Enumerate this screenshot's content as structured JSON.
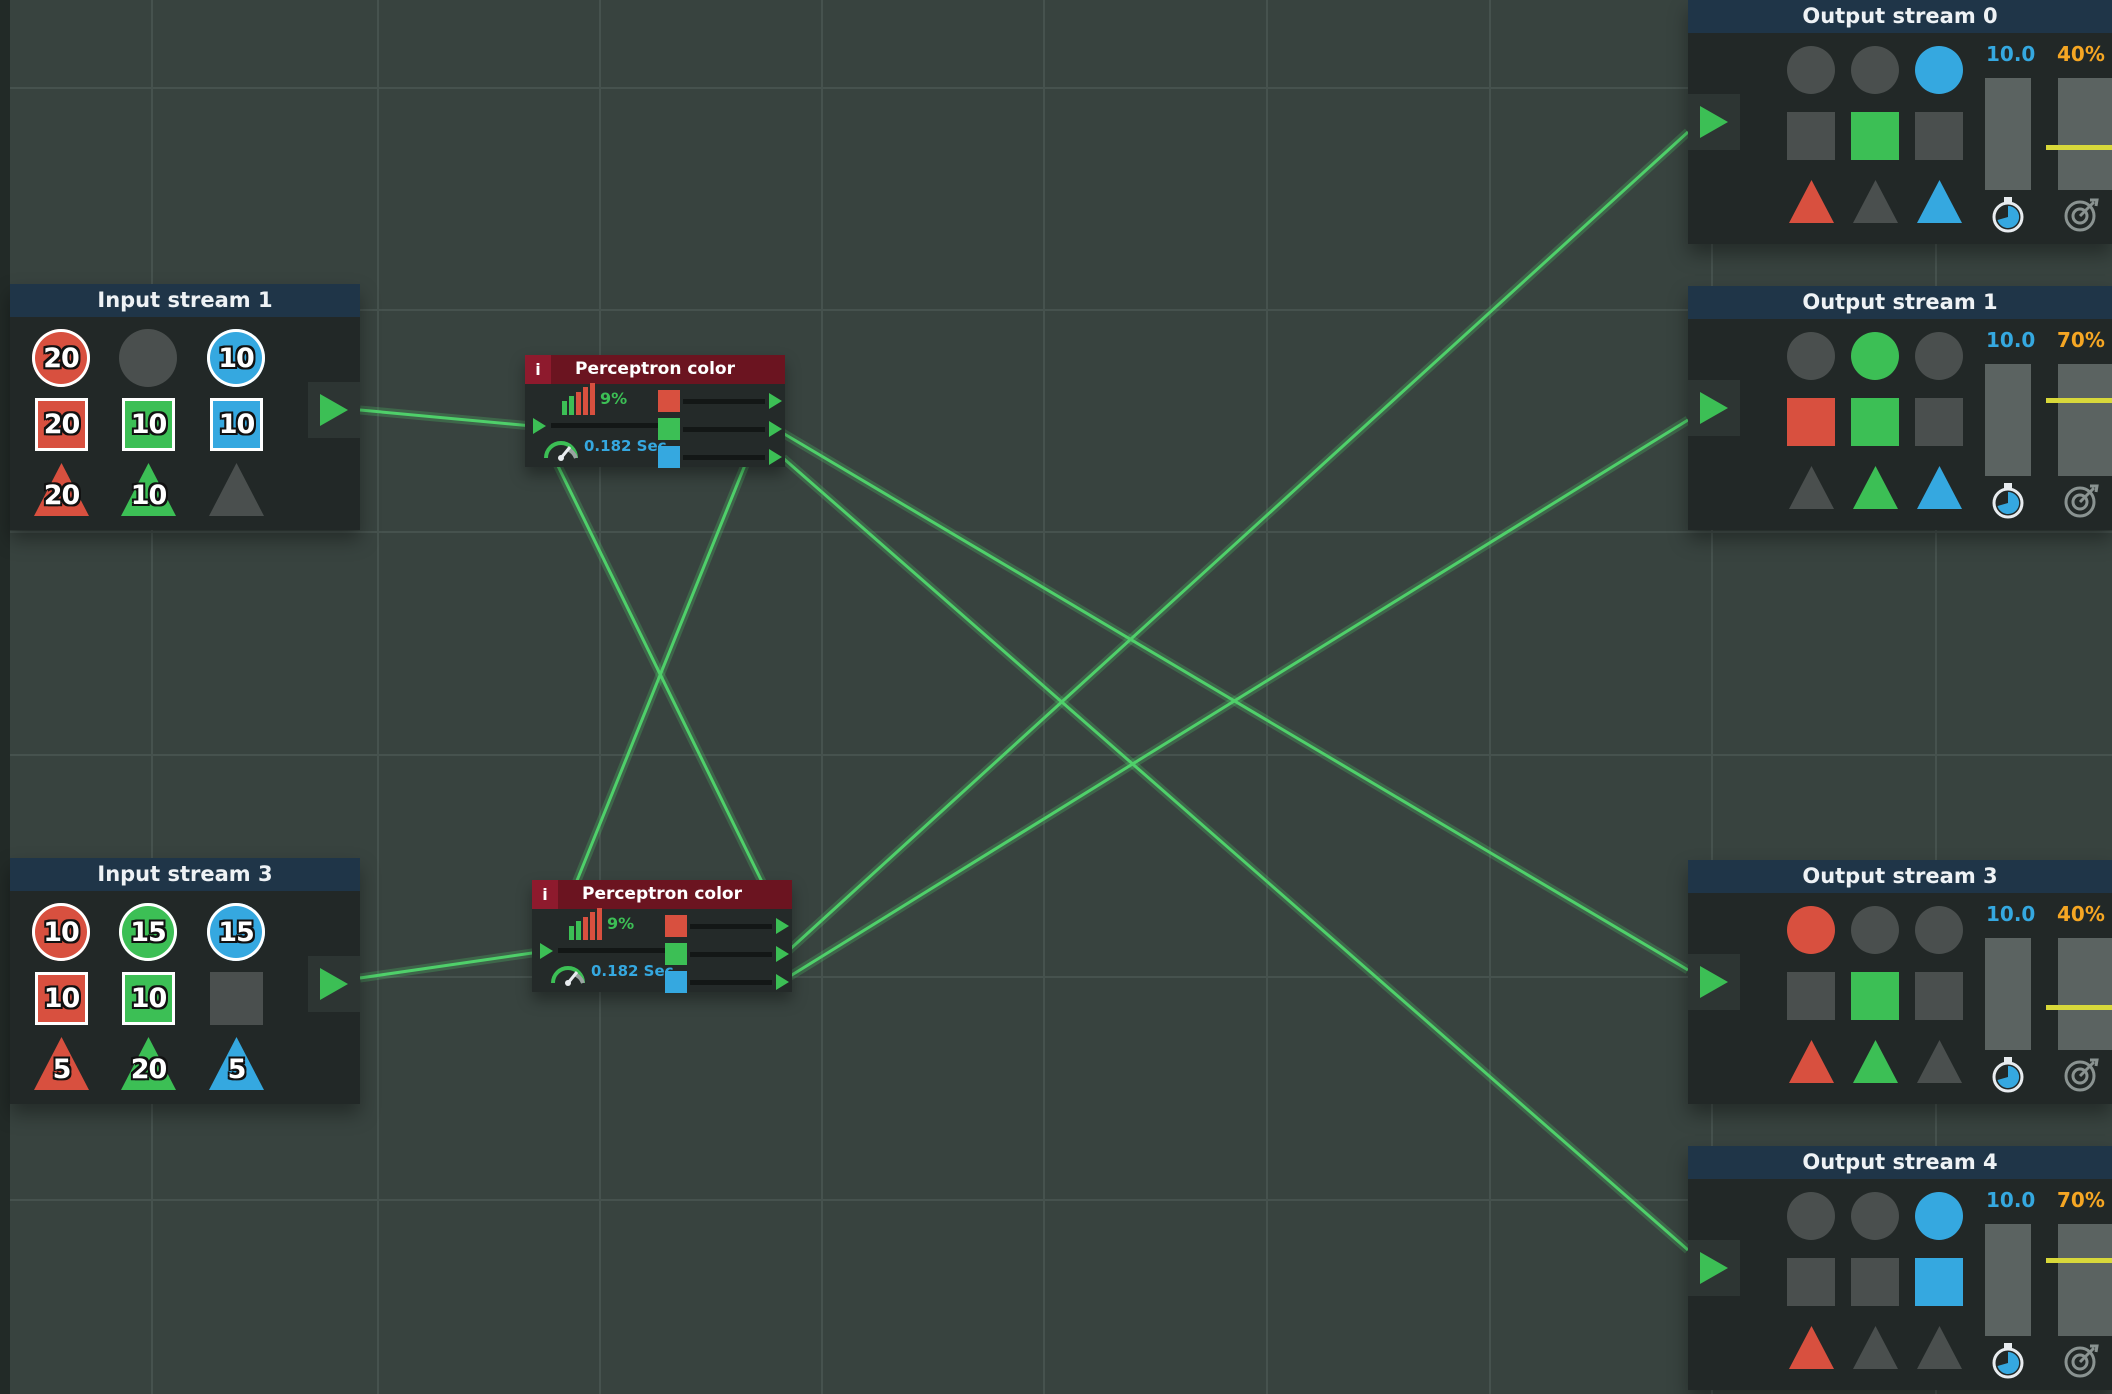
{
  "colors": {
    "red": "#d8503f",
    "green": "#3cbf55",
    "blue": "#35a8e0",
    "gray": "#4a4f4e",
    "header": "#1f3548",
    "perceptron_header": "#6b1420",
    "time_blue": "#35a8e0",
    "goal_orange": "#f5a623",
    "marker_yellow": "#d8d83a",
    "wire": "#4fd06a"
  },
  "input_streams": [
    {
      "title": "Input stream 1",
      "tokens": [
        {
          "shape": "circle",
          "color": "red",
          "count": "20"
        },
        {
          "shape": "circle",
          "color": "gray",
          "count": ""
        },
        {
          "shape": "circle",
          "color": "blue",
          "count": "10"
        },
        {
          "shape": "square",
          "color": "red",
          "count": "20"
        },
        {
          "shape": "square",
          "color": "green",
          "count": "10"
        },
        {
          "shape": "square",
          "color": "blue",
          "count": "10"
        },
        {
          "shape": "triangle",
          "color": "red",
          "count": "20"
        },
        {
          "shape": "triangle",
          "color": "green",
          "count": "10"
        },
        {
          "shape": "triangle",
          "color": "gray",
          "count": ""
        }
      ]
    },
    {
      "title": "Input stream 3",
      "tokens": [
        {
          "shape": "circle",
          "color": "red",
          "count": "10"
        },
        {
          "shape": "circle",
          "color": "green",
          "count": "15"
        },
        {
          "shape": "circle",
          "color": "blue",
          "count": "15"
        },
        {
          "shape": "square",
          "color": "red",
          "count": "10"
        },
        {
          "shape": "square",
          "color": "green",
          "count": "10"
        },
        {
          "shape": "square",
          "color": "gray",
          "count": ""
        },
        {
          "shape": "triangle",
          "color": "red",
          "count": "5"
        },
        {
          "shape": "triangle",
          "color": "green",
          "count": "20"
        },
        {
          "shape": "triangle",
          "color": "blue",
          "count": "5"
        }
      ]
    }
  ],
  "perceptrons": [
    {
      "title": "Perceptron color",
      "info_label": "i",
      "accuracy": "9%",
      "time": "0.182 Sec"
    },
    {
      "title": "Perceptron color",
      "info_label": "i",
      "accuracy": "9%",
      "time": "0.182 Sec"
    }
  ],
  "output_streams": [
    {
      "title": "Output stream 0",
      "time_value": "10.0",
      "goal_value": "40%",
      "goal_level": 0.4,
      "tokens": [
        {
          "shape": "circle",
          "color": "gray"
        },
        {
          "shape": "circle",
          "color": "gray"
        },
        {
          "shape": "circle",
          "color": "blue"
        },
        {
          "shape": "square",
          "color": "gray"
        },
        {
          "shape": "square",
          "color": "green"
        },
        {
          "shape": "square",
          "color": "gray"
        },
        {
          "shape": "triangle",
          "color": "red"
        },
        {
          "shape": "triangle",
          "color": "gray"
        },
        {
          "shape": "triangle",
          "color": "blue"
        }
      ]
    },
    {
      "title": "Output stream 1",
      "time_value": "10.0",
      "goal_value": "70%",
      "goal_level": 0.7,
      "tokens": [
        {
          "shape": "circle",
          "color": "gray"
        },
        {
          "shape": "circle",
          "color": "green"
        },
        {
          "shape": "circle",
          "color": "gray"
        },
        {
          "shape": "square",
          "color": "red"
        },
        {
          "shape": "square",
          "color": "green"
        },
        {
          "shape": "square",
          "color": "gray"
        },
        {
          "shape": "triangle",
          "color": "gray"
        },
        {
          "shape": "triangle",
          "color": "green"
        },
        {
          "shape": "triangle",
          "color": "blue"
        }
      ]
    },
    {
      "title": "Output stream 3",
      "time_value": "10.0",
      "goal_value": "40%",
      "goal_level": 0.4,
      "tokens": [
        {
          "shape": "circle",
          "color": "red"
        },
        {
          "shape": "circle",
          "color": "gray"
        },
        {
          "shape": "circle",
          "color": "gray"
        },
        {
          "shape": "square",
          "color": "gray"
        },
        {
          "shape": "square",
          "color": "green"
        },
        {
          "shape": "square",
          "color": "gray"
        },
        {
          "shape": "triangle",
          "color": "red"
        },
        {
          "shape": "triangle",
          "color": "green"
        },
        {
          "shape": "triangle",
          "color": "gray"
        }
      ]
    },
    {
      "title": "Output stream 4",
      "time_value": "10.0",
      "goal_value": "70%",
      "goal_level": 0.7,
      "tokens": [
        {
          "shape": "circle",
          "color": "gray"
        },
        {
          "shape": "circle",
          "color": "gray"
        },
        {
          "shape": "circle",
          "color": "blue"
        },
        {
          "shape": "square",
          "color": "gray"
        },
        {
          "shape": "square",
          "color": "gray"
        },
        {
          "shape": "square",
          "color": "blue"
        },
        {
          "shape": "triangle",
          "color": "red"
        },
        {
          "shape": "triangle",
          "color": "gray"
        },
        {
          "shape": "triangle",
          "color": "gray"
        }
      ]
    }
  ],
  "icons": {
    "play": "play-icon",
    "histogram": "accuracy-histogram-icon",
    "speed": "speedometer-icon",
    "timer": "stopwatch-icon",
    "goal": "target-icon",
    "info": "info-icon"
  }
}
